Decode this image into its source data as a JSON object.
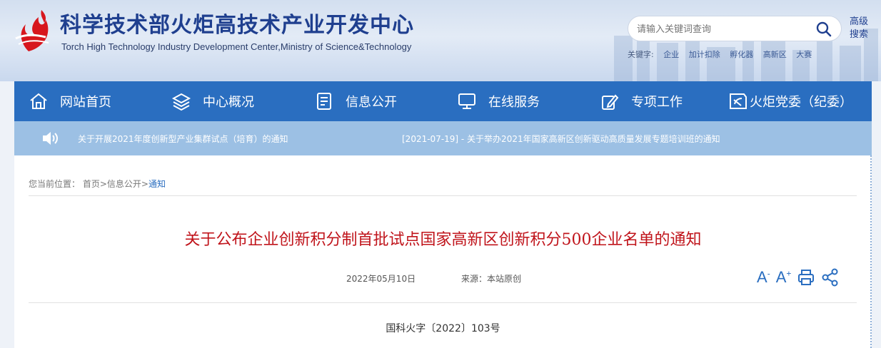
{
  "header": {
    "title": "科学技术部火炬高技术产业开发中心",
    "subtitle": "Torch High Technology Industry Development Center,Ministry of Science&Technology",
    "search_placeholder": "请输入关键词查询",
    "advanced_search_label_line1": "高级",
    "advanced_search_label_line2": "搜索",
    "keywords_label": "关键字:",
    "keywords": [
      "企业",
      "加计扣除",
      "孵化器",
      "高新区",
      "大赛"
    ]
  },
  "nav": {
    "items": [
      {
        "label": "网站首页",
        "icon": "home-icon"
      },
      {
        "label": "中心概况",
        "icon": "layers-icon"
      },
      {
        "label": "信息公开",
        "icon": "document-icon"
      },
      {
        "label": "在线服务",
        "icon": "monitor-icon"
      },
      {
        "label": "专项工作",
        "icon": "edit-icon"
      },
      {
        "label": "火炬党委（纪委）",
        "icon": "party-emblem-icon"
      }
    ]
  },
  "ticker": {
    "items": [
      "关于开展2021年度创新型产业集群试点（培育）的通知",
      "[2021-07-19] - 关于举办2021年国家高新区创新驱动高质量发展专题培训班的通知"
    ]
  },
  "breadcrumb": {
    "prefix": "您当前位置：",
    "path": "首页>信息公开>",
    "current": "通知"
  },
  "article": {
    "title": "关于公布企业创新积分制首批试点国家高新区创新积分500企业名单的通知",
    "date": "2022年05月10日",
    "source": "来源：本站原创",
    "doc_number": "国科火字〔2022〕103号"
  },
  "tools": {
    "font_decrease": "A",
    "font_increase": "A",
    "font_decrease_sup": "-",
    "font_increase_sup": "+"
  },
  "colors": {
    "nav_bg": "#2a6ec0",
    "ticker_bg": "#9cc0e4",
    "title_red": "#c0141b",
    "brand_blue": "#1f3f8f",
    "logo_red": "#d7161d"
  }
}
